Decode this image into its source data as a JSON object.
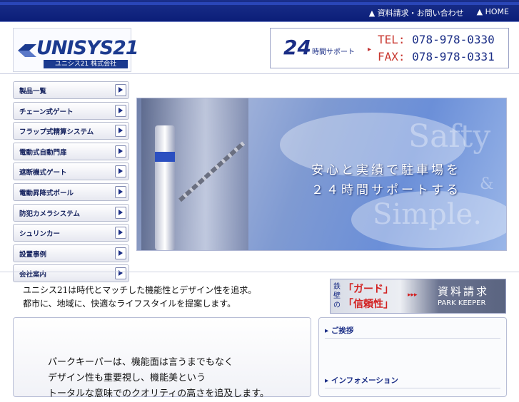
{
  "topnav": {
    "request": "▲ 資料請求・お問い合わせ",
    "home": "▲ HOME"
  },
  "logo": {
    "name": "UNISYS21",
    "sub": "ユニシス21 株式会社"
  },
  "contact": {
    "hours": "24",
    "support": "時間サポート",
    "arrow": "▸",
    "tel_label": "TEL:",
    "tel": "078-978-0330",
    "fax_label": "FAX:",
    "fax": "078-978-0331"
  },
  "sidebar": {
    "items": [
      {
        "label": "製品一覧"
      },
      {
        "label": "チェーン式ゲート"
      },
      {
        "label": "フラップ式精算システム"
      },
      {
        "label": "電動式自動門扉"
      },
      {
        "label": "遮断機式ゲート"
      },
      {
        "label": "電動昇降式ポール"
      },
      {
        "label": "防犯カメラシステム"
      },
      {
        "label": "シュリンカー"
      },
      {
        "label": "設置事例"
      },
      {
        "label": "会社案内"
      }
    ]
  },
  "hero": {
    "catch_line1": "安心と実績で駐車場を",
    "catch_line2": "２４時間サポートする",
    "bg_word1": "Safty",
    "bg_word2": "&",
    "bg_word3": "Simple."
  },
  "tagline": {
    "line1": "ユニシス21は時代とマッチした機能性とデザイン性を追求。",
    "line2": "都市に、地域に、快適なライフスタイルを提案します。"
  },
  "banner": {
    "tetsu": "鉄壁の",
    "guard": "「ガード」",
    "trust": "「信頼性」",
    "dots": "▸▸▸",
    "request": "資料請求",
    "parkkeeper": "PARK KEEPER"
  },
  "intro": {
    "line1": "パークキーパーは、機能面は言うまでもなく",
    "line2": "デザイン性も重要視し、機能美という",
    "line3": "トータルな意味でのクオリティの高さを追及します。"
  },
  "rightpanel": {
    "greeting": "▸ ご挨拶",
    "info": "▸ インフォメーション"
  }
}
